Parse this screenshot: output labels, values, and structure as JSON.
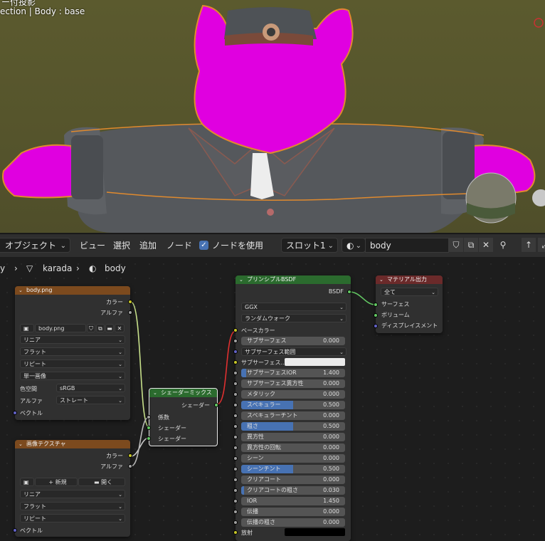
{
  "viewport": {
    "top_line": "ー付投影",
    "collection": "ection | Body : base"
  },
  "header": {
    "mode": "オブジェクト",
    "menu": [
      "ビュー",
      "選択",
      "追加",
      "ノード"
    ],
    "use_nodes_label": "ノードを使用",
    "use_nodes_checked": true,
    "slot": "スロット1",
    "material_name": "body"
  },
  "breadcrumb": {
    "obj_tail": "y",
    "mesh": "karada",
    "material": "body"
  },
  "nodes": {
    "image1": {
      "title": "body.png",
      "out_color": "カラー",
      "out_alpha": "アルファ",
      "image_name": "body.png",
      "interp": "リニア",
      "projection": "フラット",
      "extension": "リピート",
      "source": "単一画像",
      "colorspace_label": "色空間",
      "colorspace": "sRGB",
      "alpha_label": "アルファ",
      "alpha_mode": "ストレート",
      "in_vector": "ベクトル"
    },
    "image2": {
      "title": "画像テクスチャ",
      "out_color": "カラー",
      "out_alpha": "アルファ",
      "new_label": "新規",
      "open_label": "開く",
      "interp": "リニア",
      "projection": "フラット",
      "extension": "リピート",
      "in_vector": "ベクトル"
    },
    "mix": {
      "title": "シェーダーミックス",
      "out": "シェーダー",
      "in_fac": "係数",
      "in_s1": "シェーダー",
      "in_s2": "シェーダー"
    },
    "bsdf": {
      "title": "プリンシプルBSDF",
      "out": "BSDF",
      "distribution": "GGX",
      "subsurface_method": "ランダムウォーク",
      "base_color": "ベースカラー",
      "subsurface_color": "サブサーフェス...",
      "subsurface_radius": "サブサーフェス範囲",
      "emission": "放射",
      "params": [
        {
          "label": "サブサーフェス",
          "value": "0.000",
          "fill": 0
        },
        {
          "label": "サブサーフェスIOR",
          "value": "1.400",
          "fill": 0.05
        },
        {
          "label": "サブサーフェス異方性",
          "value": "0.000",
          "fill": 0
        },
        {
          "label": "メタリック",
          "value": "0.000",
          "fill": 0
        },
        {
          "label": "スペキュラー",
          "value": "0.500",
          "fill": 0.5
        },
        {
          "label": "スペキュラーチント",
          "value": "0.000",
          "fill": 0
        },
        {
          "label": "粗さ",
          "value": "0.500",
          "fill": 0.5
        },
        {
          "label": "異方性",
          "value": "0.000",
          "fill": 0
        },
        {
          "label": "異方性の回転",
          "value": "0.000",
          "fill": 0
        },
        {
          "label": "シーン",
          "value": "0.000",
          "fill": 0
        },
        {
          "label": "シーンチント",
          "value": "0.500",
          "fill": 0.5
        },
        {
          "label": "クリアコート",
          "value": "0.000",
          "fill": 0
        },
        {
          "label": "クリアコートの粗さ",
          "value": "0.030",
          "fill": 0.03
        },
        {
          "label": "IOR",
          "value": "1.450",
          "fill": 0
        },
        {
          "label": "伝播",
          "value": "0.000",
          "fill": 0
        },
        {
          "label": "伝播の粗さ",
          "value": "0.000",
          "fill": 0
        }
      ]
    },
    "output": {
      "title": "マテリアル出力",
      "target": "全て",
      "in_surface": "サーフェス",
      "in_volume": "ボリューム",
      "in_displacement": "ディスプレイスメント"
    }
  },
  "colors": {
    "header_texture": "#7c4a1e",
    "header_shader": "#2b6b2e",
    "header_output": "#6b2a2a",
    "selection": "#e08a2e",
    "magenta": "#e000e0"
  }
}
